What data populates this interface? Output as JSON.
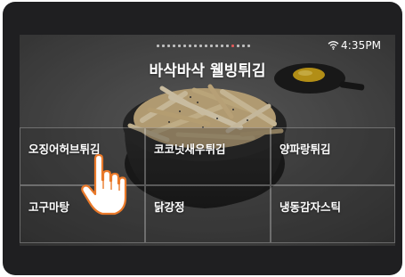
{
  "status": {
    "time": "4:35PM",
    "page_count": 18,
    "active_page": 14
  },
  "screen": {
    "title": "바삭바삭 웰빙튀김"
  },
  "menu": {
    "items": [
      {
        "label": "오징어허브튀김"
      },
      {
        "label": "코코넛새우튀김"
      },
      {
        "label": "양파랑튀김"
      },
      {
        "label": "고구마탕"
      },
      {
        "label": "닭강정"
      },
      {
        "label": "냉동감자스틱"
      }
    ]
  },
  "icons": {
    "wifi": "wifi-icon",
    "pointer": "hand-pointer-icon"
  },
  "colors": {
    "device_frame": "#1f1f21",
    "active_dot": "#e05a5a",
    "text": "#ffffff"
  }
}
